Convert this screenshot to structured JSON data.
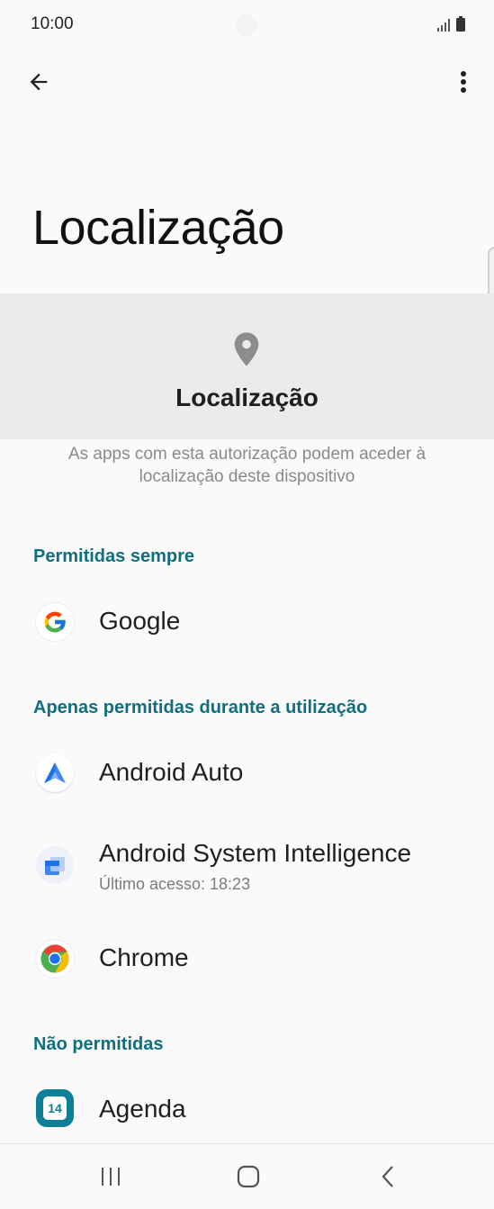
{
  "status": {
    "time": "10:00"
  },
  "toolbar": {
    "back_icon": "arrow-back-icon",
    "more_icon": "more-vert-icon"
  },
  "page": {
    "title": "Localização"
  },
  "hero": {
    "icon": "location-pin-icon",
    "title": "Localização"
  },
  "description": "As apps com esta autorização podem aceder à localização deste dispositivo",
  "sections": {
    "always": {
      "header": "Permitidas sempre",
      "apps": [
        {
          "name": "Google",
          "icon": "google-icon"
        }
      ]
    },
    "while_using": {
      "header": "Apenas permitidas durante a utilização",
      "apps": [
        {
          "name": "Android Auto",
          "icon": "android-auto-icon"
        },
        {
          "name": "Android System Intelligence",
          "subtitle": "Último acesso: 18:23",
          "icon": "android-system-intelligence-icon"
        },
        {
          "name": "Chrome",
          "icon": "chrome-icon"
        }
      ]
    },
    "denied": {
      "header": "Não permitidas",
      "apps": [
        {
          "name": "Agenda",
          "icon": "calendar-icon",
          "icon_text": "14"
        }
      ]
    }
  },
  "navbar": {
    "recents": "recents-icon",
    "home": "home-icon",
    "back": "nav-back-icon"
  },
  "colors": {
    "accent": "#0e6f80",
    "hero_bg": "#ebebeb",
    "background": "#fafafa"
  }
}
